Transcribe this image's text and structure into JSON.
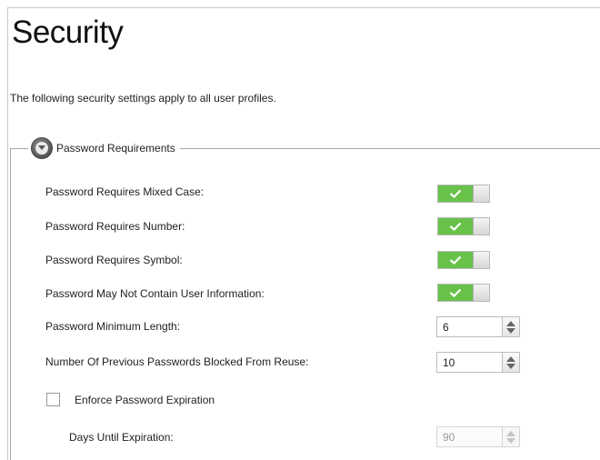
{
  "page": {
    "title": "Security",
    "intro": "The following security settings apply to all user profiles."
  },
  "password_section": {
    "legend": "Password Requirements",
    "toggles": [
      {
        "label": "Password Requires Mixed Case:",
        "on": true
      },
      {
        "label": "Password Requires Number:",
        "on": true
      },
      {
        "label": "Password Requires Symbol:",
        "on": true
      },
      {
        "label": "Password May Not Contain User Information:",
        "on": true
      }
    ],
    "min_length": {
      "label": "Password Minimum Length:",
      "value": "6"
    },
    "previous_blocked": {
      "label": "Number Of Previous Passwords Blocked From Reuse:",
      "value": "10"
    },
    "expiration": {
      "label": "Enforce Password Expiration",
      "checked": false,
      "days_label": "Days Until Expiration:",
      "days_value": "90",
      "days_enabled": false
    }
  },
  "icons": {
    "collapse": "chevron-down-circle-icon",
    "toggle_on": "checkmark-icon",
    "spinner": "up-down-arrows-icon"
  },
  "colors": {
    "toggle_on": "#68c24a",
    "rule": "#a8a8a8"
  }
}
